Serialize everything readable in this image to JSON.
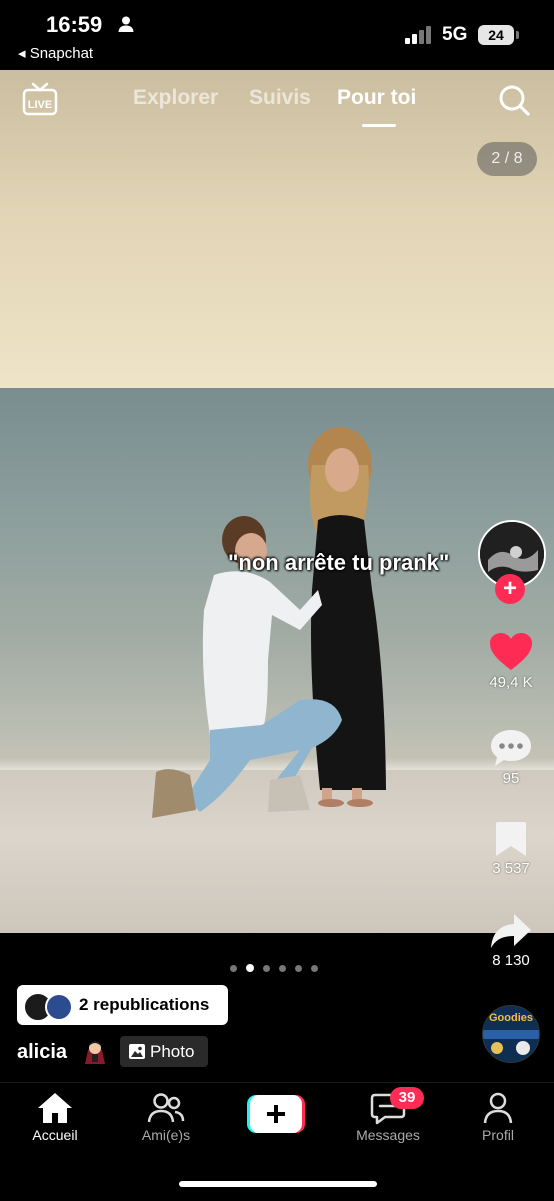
{
  "status_bar": {
    "time": "16:59",
    "back_app": "◂ Snapchat",
    "network": "5G",
    "battery": "24"
  },
  "top_nav": {
    "tabs": [
      "Explorer",
      "Suivis",
      "Pour toi"
    ],
    "active_tab": "Pour toi"
  },
  "post": {
    "counter": "2 / 8",
    "caption": "\"non arrête tu prank\"",
    "likes": "49,4 K",
    "comments": "95",
    "saves": "3 537",
    "shares": "8 130",
    "republications": "2 republications",
    "username": "alicia",
    "type_badge": "Photo",
    "carousel_total": 6,
    "carousel_active": 1,
    "music_disc_text": "Goodies"
  },
  "bottom_nav": {
    "home": "Accueil",
    "friends": "Ami(e)s",
    "messages": "Messages",
    "messages_badge": "39",
    "profile": "Profil"
  },
  "colors": {
    "accent": "#fe2c55",
    "like": "#fe2c55",
    "background": "#000000"
  }
}
